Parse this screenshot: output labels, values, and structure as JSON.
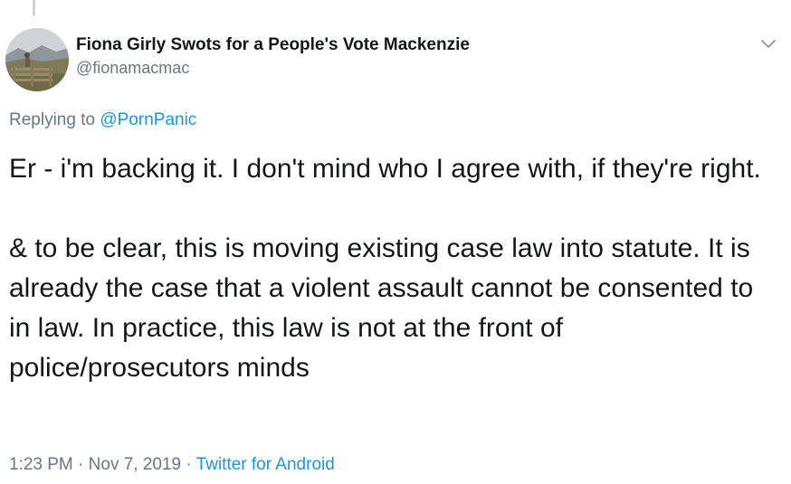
{
  "author": {
    "display_name": "Fiona Girly Swots for a People's Vote Mackenzie",
    "handle": "@fionamacmac"
  },
  "reply": {
    "prefix": "Replying to ",
    "mention": "@PornPanic"
  },
  "tweet": {
    "paragraphs": [
      "Er - i'm backing it. I don't mind who I agree with, if they're right.",
      "& to be clear, this is moving existing case law into statute. It is already the case that a violent assault cannot be consented to in law. In practice, this law is not at the front of police/prosecutors minds"
    ]
  },
  "meta": {
    "time": "1:23 PM",
    "separator_1": " · ",
    "date": "Nov 7, 2019",
    "separator_2": " · ",
    "source": "Twitter for Android"
  },
  "icons": {
    "menu": "chevron-down-icon"
  },
  "colors": {
    "link": "#1b95e0",
    "secondary_text": "#657786",
    "primary_text": "#14171a"
  }
}
